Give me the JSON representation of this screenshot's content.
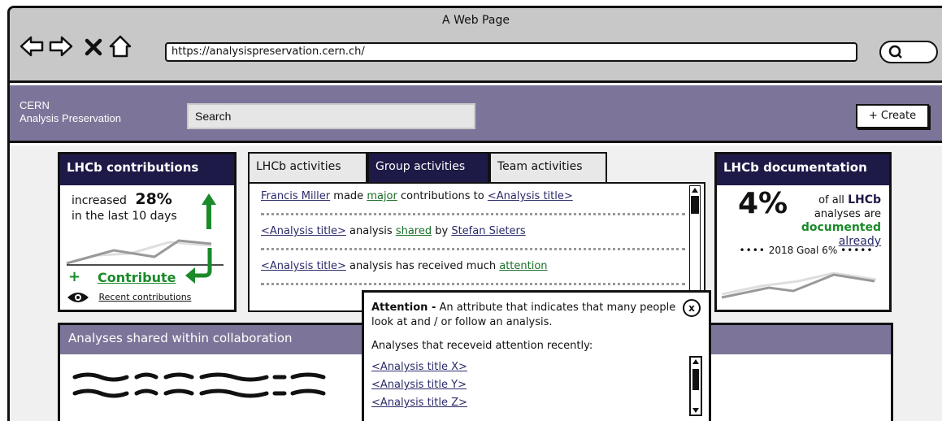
{
  "browser": {
    "window_title": "A Web Page",
    "url": "https://analysispreservation.cern.ch/",
    "nav_icons": [
      "back-arrow-icon",
      "forward-arrow-icon",
      "close-icon",
      "home-icon"
    ]
  },
  "header": {
    "brand_line1": "CERN",
    "brand_line2": "Analysis Preservation",
    "search_value": "Search",
    "create_label": "+ Create",
    "color": "#7d7599"
  },
  "contributions": {
    "title": "LHCb contributions",
    "line1": "increased",
    "percent": "28%",
    "line2": "in the last 10 days",
    "contribute_label": "Contribute",
    "contribute_plus": "+",
    "recent_label": "Recent contributions"
  },
  "activities": {
    "tabs": [
      "LHCb activities",
      "Group activities",
      "Team activities"
    ],
    "active_tab": "Group activities",
    "items": [
      {
        "a": "Francis Miller",
        "b": " made ",
        "c": "major",
        "d": " contributions to ",
        "e": "<Analysis title>"
      },
      {
        "a": "<Analysis title>",
        "b": " analysis ",
        "c": "shared",
        "d": " by ",
        "e": "Stefan Sieters"
      },
      {
        "a": "<Analysis title>",
        "b": " analysis has received much ",
        "c": "attention"
      }
    ]
  },
  "documentation": {
    "title": "LHCb documentation",
    "percent": "4%",
    "text1": "of all",
    "lhcb": "LHCb",
    "text2": "analyses are",
    "documented": "documented",
    "already": "already",
    "goal": "2018 Goal 6%"
  },
  "shared": {
    "title": "Analyses shared within collaboration"
  },
  "popup": {
    "term": "Attention -",
    "definition": " An attribute that indicates that many people look at and / or follow an analysis.",
    "subtitle": "Analyses that receveid attention recently:",
    "links": [
      "<Analysis title X>",
      "<Analysis title Y>",
      "<Analysis title Z>"
    ],
    "close_label": "x"
  },
  "colors": {
    "dark_navy": "#1e1a48",
    "purple": "#7d7599",
    "green": "#1a8a2a"
  }
}
